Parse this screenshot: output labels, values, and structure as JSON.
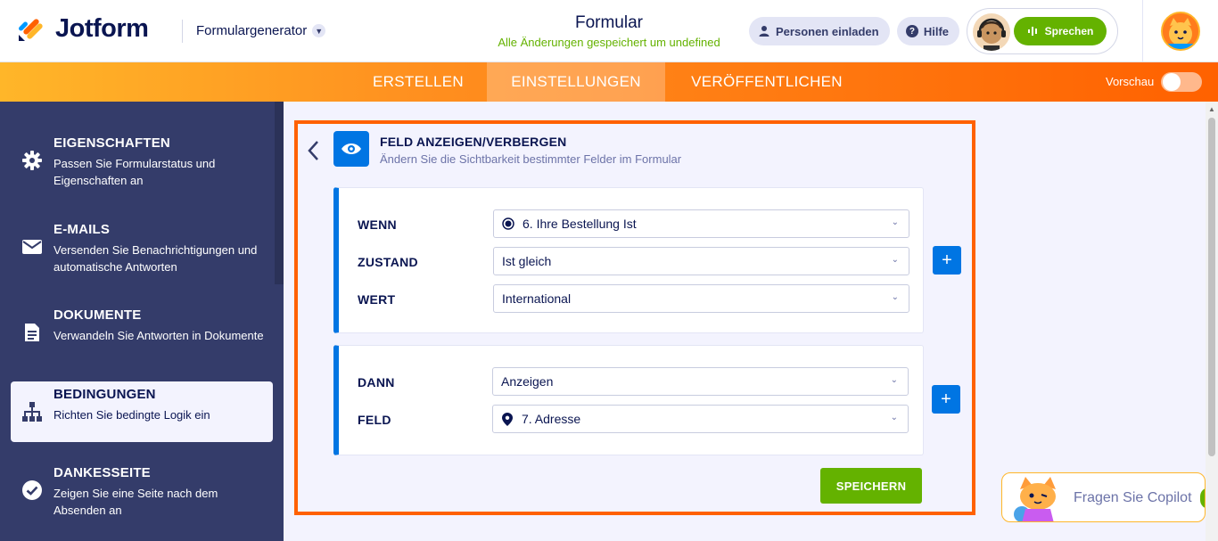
{
  "header": {
    "brand": "Jotform",
    "product": "Formulargenerator",
    "form_title": "Formular",
    "save_status": "Alle Änderungen gespeichert um undefined",
    "invite_label": "Personen einladen",
    "help_label": "Hilfe",
    "speak_label": "Sprechen"
  },
  "nav": {
    "tabs": [
      {
        "label": "ERSTELLEN",
        "active": false
      },
      {
        "label": "EINSTELLUNGEN",
        "active": true
      },
      {
        "label": "VERÖFFENTLICHEN",
        "active": false
      }
    ],
    "preview_label": "Vorschau",
    "preview_on": false
  },
  "sidebar": {
    "items": [
      {
        "title": "EIGENSCHAFTEN",
        "desc": "Passen Sie Formularstatus und Eigenschaften an",
        "icon": "gear-icon"
      },
      {
        "title": "E-MAILS",
        "desc": "Versenden Sie Benachrichtigungen und automatische Antworten",
        "icon": "envelope-icon"
      },
      {
        "title": "DOKUMENTE",
        "desc": "Verwandeln Sie Antworten in Dokumente",
        "icon": "document-icon"
      },
      {
        "title": "BEDINGUNGEN",
        "desc": "Richten Sie bedingte Logik ein",
        "icon": "sitemap-icon",
        "active": true
      },
      {
        "title": "DANKESSEITE",
        "desc": "Zeigen Sie eine Seite nach dem Absenden an",
        "icon": "check-circle-icon"
      }
    ]
  },
  "panel": {
    "title": "FELD ANZEIGEN/VERBERGEN",
    "subtitle": "Ändern Sie die Sichtbarkeit bestimmter Felder im Formular",
    "condition": {
      "if_label": "WENN",
      "if_value": "6. Ihre Bestellung Ist",
      "state_label": "ZUSTAND",
      "state_value": "Ist gleich",
      "value_label": "WERT",
      "value_value": "International"
    },
    "action": {
      "then_label": "DANN",
      "then_value": "Anzeigen",
      "field_label": "FELD",
      "field_value": "7. Adresse"
    },
    "add_symbol": "+",
    "save_label": "SPEICHERN"
  },
  "copilot": {
    "label": "Fragen Sie Copilot"
  },
  "colors": {
    "accent_orange": "#ff6100",
    "brand_blue": "#0075e3",
    "save_green": "#64b200",
    "sidebar_bg": "#343c6a",
    "navy_text": "#0a1551"
  }
}
